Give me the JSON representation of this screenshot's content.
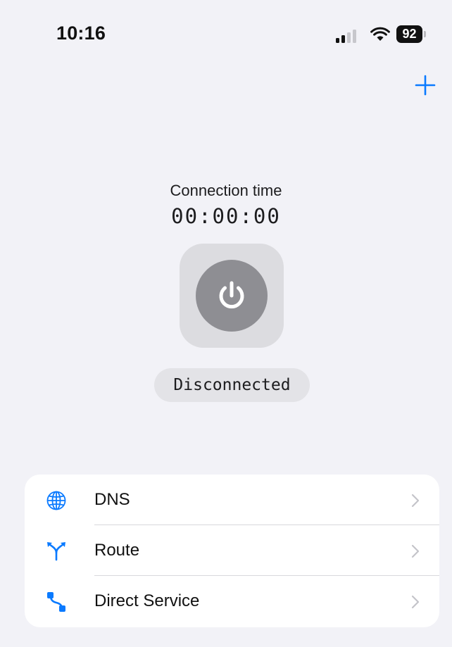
{
  "status_bar": {
    "time": "10:16",
    "battery": "92"
  },
  "toolbar": {
    "add_icon": "plus-icon"
  },
  "connection": {
    "label": "Connection time",
    "timer": "00:00:00",
    "status": "Disconnected",
    "power_icon": "power-icon"
  },
  "menu": {
    "items": [
      {
        "label": "DNS",
        "icon": "globe-icon"
      },
      {
        "label": "Route",
        "icon": "route-fork-icon"
      },
      {
        "label": "Direct Service",
        "icon": "direct-path-icon"
      }
    ]
  },
  "colors": {
    "accent": "#0a7aff",
    "background": "#f2f2f7",
    "power_gray": "#8e8e93"
  }
}
